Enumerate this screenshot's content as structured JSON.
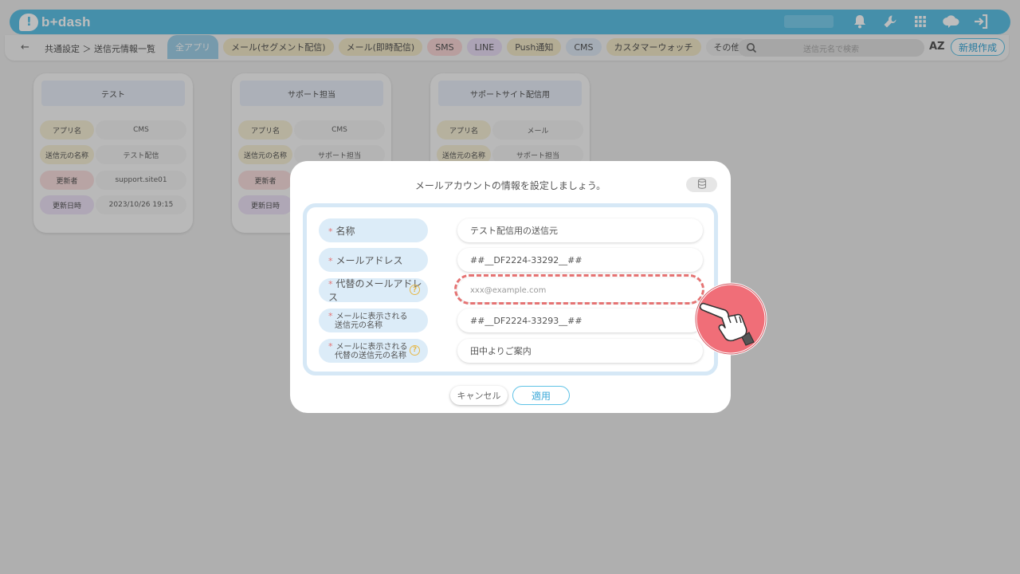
{
  "app": {
    "logo_text": "b+dash"
  },
  "topbar": {
    "icons": [
      "bell-icon",
      "wrench-icon",
      "grid-icon",
      "cloud-chat-icon",
      "logout-icon"
    ]
  },
  "nav": {
    "back_icon": "←",
    "breadcrumb": "共通設定 ＞ 送信元情報一覧",
    "tabs": [
      {
        "label": "全アプリ",
        "color": "#9fd0e8"
      },
      {
        "label": "メール(セグメント配信)",
        "color": "#f2e8c8"
      },
      {
        "label": "メール(即時配信)",
        "color": "#f2e8c8"
      },
      {
        "label": "SMS",
        "color": "#f8d6d6"
      },
      {
        "label": "LINE",
        "color": "#e8dcf4"
      },
      {
        "label": "Push通知",
        "color": "#f2e8c8"
      },
      {
        "label": "CMS",
        "color": "#dde8f4"
      },
      {
        "label": "カスタマーウォッチ",
        "color": "#f2e8c8"
      },
      {
        "label": "その他",
        "color": "#ebebeb"
      }
    ],
    "search_placeholder": "送信元名で検索",
    "sort_label": "AZ",
    "new_button": "新規作成"
  },
  "cards": [
    {
      "title": "テスト",
      "rows": [
        {
          "label": "アプリ名",
          "value": "CMS",
          "color": "#f6efd6"
        },
        {
          "label": "送信元の名称",
          "value": "テスト配信",
          "color": "#f6efd6"
        },
        {
          "label": "更新者",
          "value": "support.site01",
          "color": "#f8dede"
        },
        {
          "label": "更新日時",
          "value": "2023/10/26 19:15",
          "color": "#ece2f6"
        }
      ]
    },
    {
      "title": "サポート担当",
      "rows": [
        {
          "label": "アプリ名",
          "value": "CMS",
          "color": "#f6efd6"
        },
        {
          "label": "送信元の名称",
          "value": "サポート担当",
          "color": "#f6efd6"
        },
        {
          "label": "更新者",
          "value": "",
          "color": "#f8dede"
        },
        {
          "label": "更新日時",
          "value": "",
          "color": "#ece2f6"
        }
      ]
    },
    {
      "title": "サポートサイト配信用",
      "rows": [
        {
          "label": "アプリ名",
          "value": "メール",
          "color": "#f6efd6"
        },
        {
          "label": "送信元の名称",
          "value": "サポート担当",
          "color": "#f6efd6"
        }
      ]
    }
  ],
  "modal": {
    "title": "メールアカウントの情報を設定しましょう。",
    "db_icon": "database-icon",
    "fields": [
      {
        "label": "名称",
        "value": "テスト配信用の送信元",
        "placeholder": false,
        "help": false
      },
      {
        "label": "メールアドレス",
        "value": "##__DF2224-33292__##",
        "placeholder": false,
        "help": false
      },
      {
        "label": "代替のメールアドレス",
        "value": "xxx@example.com",
        "placeholder": true,
        "help": true
      },
      {
        "label_line1": "メールに表示される",
        "label_line2": "送信元の名称",
        "value": "##__DF2224-33293__##",
        "placeholder": false,
        "help": false
      },
      {
        "label_line1": "メールに表示される",
        "label_line2": "代替の送信元の名称",
        "value": "田中よりご案内",
        "placeholder": false,
        "help": true
      }
    ],
    "required_mark": "*",
    "help_mark": "?",
    "cancel_label": "キャンセル",
    "apply_label": "適用"
  },
  "accent_color": "#5ec2e6",
  "highlight_color": "#e57373"
}
